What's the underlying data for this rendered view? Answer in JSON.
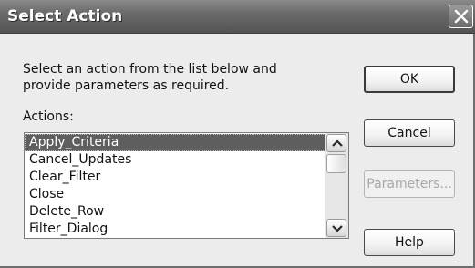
{
  "dialog": {
    "title": "Select Action",
    "instruction": "Select an action from the list below and provide parameters as required.",
    "actions_label": "Actions:",
    "actions": [
      "Apply_Criteria",
      "Cancel_Updates",
      "Clear_Filter",
      "Close",
      "Delete_Row",
      "Filter_Dialog"
    ],
    "selected_action": "Apply_Criteria",
    "buttons": {
      "ok": "OK",
      "cancel": "Cancel",
      "parameters": "Parameters...",
      "help": "Help"
    }
  },
  "icons": {
    "close": "close-icon",
    "scroll_up": "chevron-up-icon",
    "scroll_down": "chevron-down-icon"
  },
  "colors": {
    "titlebar": "#6a6a6a",
    "selection": "#5e5e5e",
    "dialog_bg": "#ececec"
  }
}
